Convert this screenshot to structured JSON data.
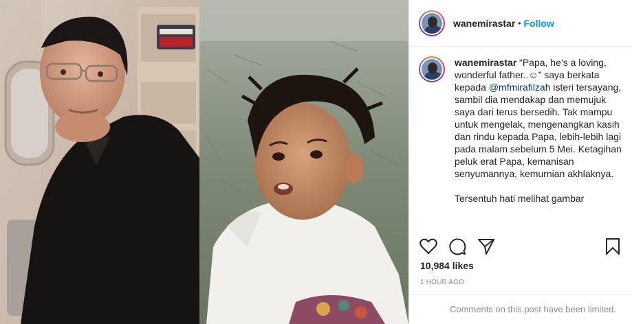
{
  "post": {
    "username": "wanemirastar",
    "follow_label": "Follow",
    "separator": "•"
  },
  "caption": {
    "username": "wanemirastar",
    "line1": " “Papa, he’s a loving, wonderful father..☺” saya berkata kepada ",
    "mention": "@mfmirafilzah",
    "line2": " isteri tersayang, sambil dia mendakap dan memujuk saya dari terus bersedih. Tak mampu untuk mengelak, mengenangkan kasih dan rindu kepada Papa, lebih-lebih lagi pada malam sebelum 5 Mei. Ketagihan peluk erat Papa, kemanisan senyumannya, kemurnian akhlaknya.",
    "para2": "Tersentuh hati melihat gambar"
  },
  "stats": {
    "likes": "10,984 likes",
    "time": "1 HOUR AGO"
  },
  "comments": {
    "notice": "Comments on this post have been limited."
  },
  "icons": {
    "like": "heart-icon",
    "comment": "comment-bubble-icon",
    "share": "paper-plane-icon",
    "save": "bookmark-icon"
  },
  "colors": {
    "link": "#0095f6",
    "text": "#262626",
    "muted": "#8e8e8e",
    "border": "#efefef"
  }
}
